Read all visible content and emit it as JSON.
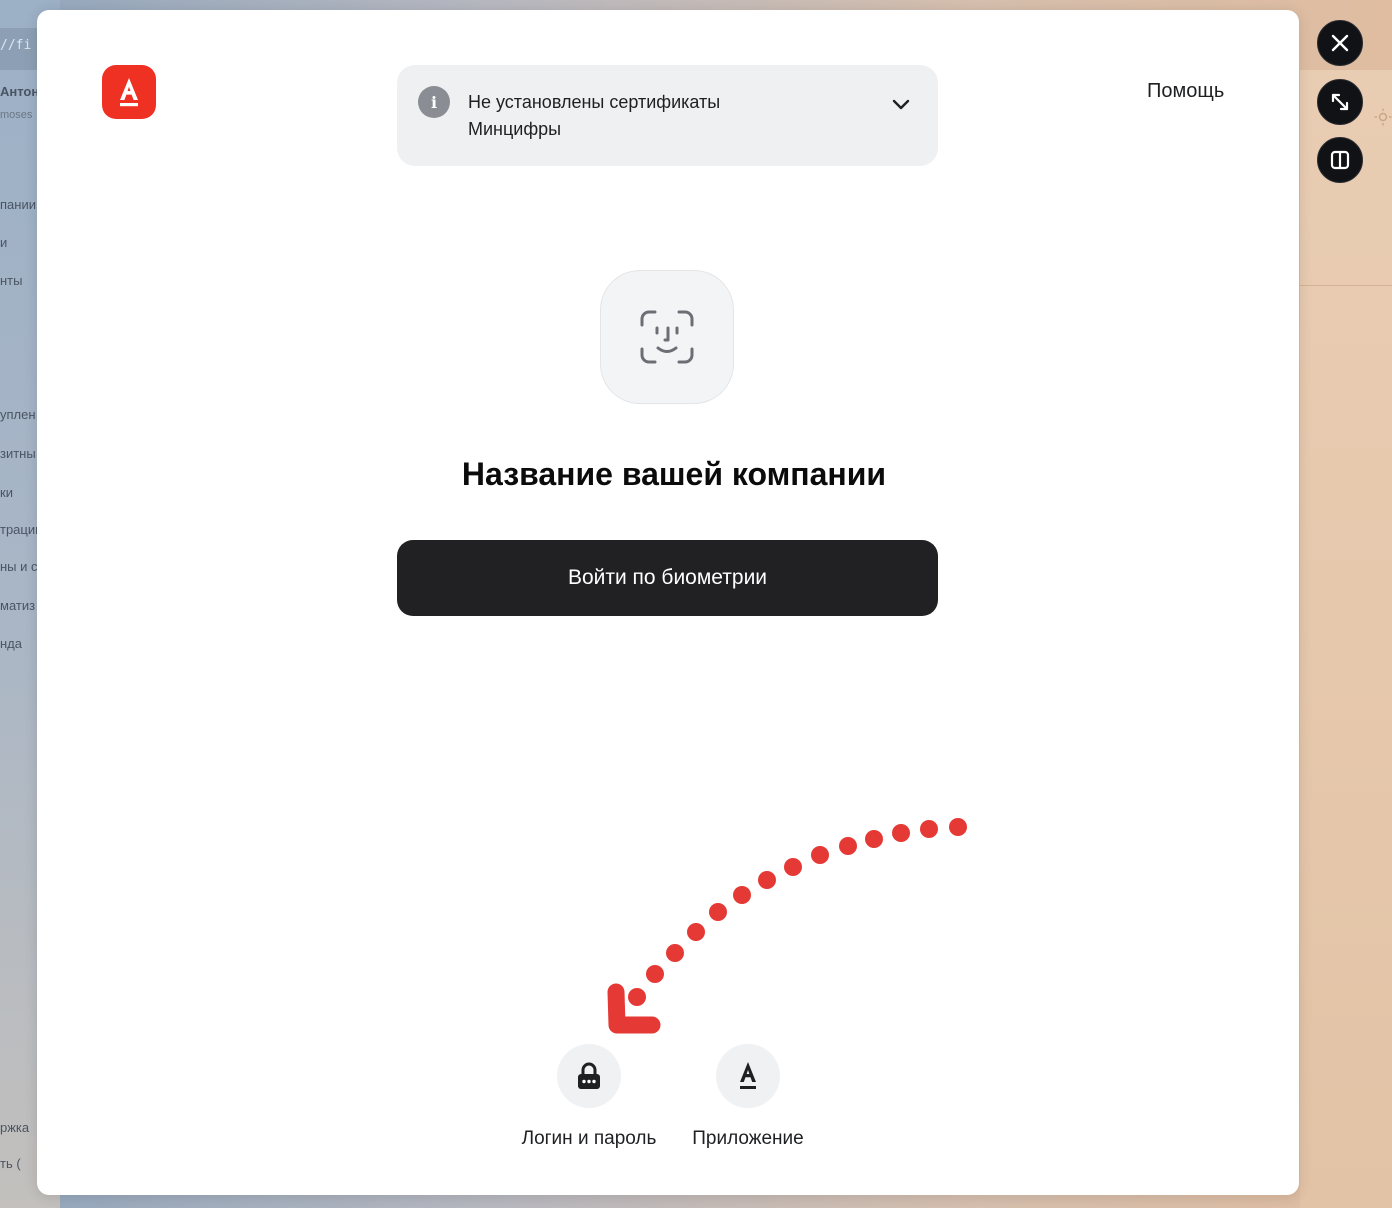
{
  "background": {
    "url_fragment": "//fi",
    "user_name": "Антон",
    "user_sub": "moses",
    "left_menu": [
      "пании",
      "и",
      "нты",
      "уплен",
      "зитны",
      "ки",
      "трации",
      "ны и с",
      "матиз",
      "нда",
      "ржка",
      "ть  ("
    ]
  },
  "modal": {
    "logo_letter": "A",
    "notice": {
      "text": "Не установлены сертификаты Минцифры",
      "icon_glyph": "i"
    },
    "help_label": "Помощь",
    "company_title": "Название вашей компании",
    "biometric_button": "Войти по биометрии",
    "options": [
      {
        "label": "Логин и пароль",
        "icon": "lock-icon"
      },
      {
        "label": "Приложение",
        "icon": "app-logo-icon",
        "glyph": "A"
      }
    ]
  },
  "colors": {
    "brand_red": "#ef3124",
    "button_dark": "#212124",
    "annotation_red": "#e53935"
  }
}
